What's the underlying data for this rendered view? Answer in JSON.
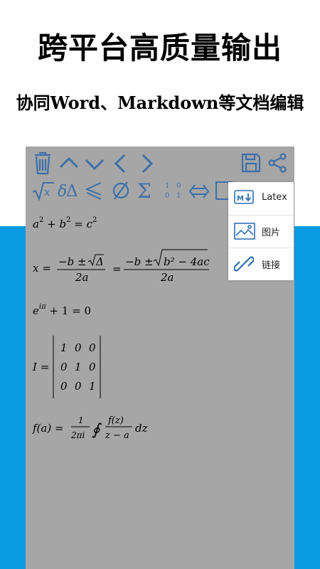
{
  "promo": {
    "title": "跨平台高质量输出",
    "subtitle": "协同Word、Markdown等文档编辑"
  },
  "toolbar": {
    "row1": [
      "trash-icon",
      "chevron-up-icon",
      "chevron-down-icon",
      "chevron-left-icon",
      "chevron-right-icon",
      "save-icon",
      "share-icon"
    ],
    "row2": [
      "sqrt-icon",
      "delta-icon",
      "less-equal-icon",
      "empty-set-icon",
      "sigma-icon",
      "matrix-icon",
      "double-arrow-icon",
      "box-icon"
    ],
    "matrix_digits": [
      "1",
      "0",
      "0",
      "1"
    ]
  },
  "formulas": {
    "f1": {
      "a": "a",
      "two": "2",
      "plus": "+",
      "b": "b",
      "eq": "=",
      "c": "c"
    },
    "f2": {
      "lhs": "x =",
      "num1": "−b ± ",
      "delta": "Δ",
      "den": "2a",
      "eq": "=",
      "num2": "−b ± ",
      "rad2": "b² − 4ac"
    },
    "f3": {
      "base": "e",
      "exp": "iπ",
      "rest": "+ 1 = 0"
    },
    "f4": {
      "lhs": "I =",
      "rows": [
        [
          "1",
          "0",
          "0"
        ],
        [
          "0",
          "1",
          "0"
        ],
        [
          "0",
          "0",
          "1"
        ]
      ]
    },
    "f5": {
      "lhs": "f(a) =",
      "coef_num": "1",
      "coef_den": "2πi",
      "int": "∮",
      "frac_num": "f(z)",
      "frac_den": "z − a",
      "dz": "dz"
    }
  },
  "menu": {
    "items": [
      {
        "icon": "markdown-icon",
        "label": "Latex"
      },
      {
        "icon": "image-icon",
        "label": "图片"
      },
      {
        "icon": "link-icon",
        "label": "链接"
      }
    ]
  },
  "colors": {
    "band": "#0b9be0",
    "panel": "#a6a6a6",
    "icon": "#3d6fa8"
  }
}
